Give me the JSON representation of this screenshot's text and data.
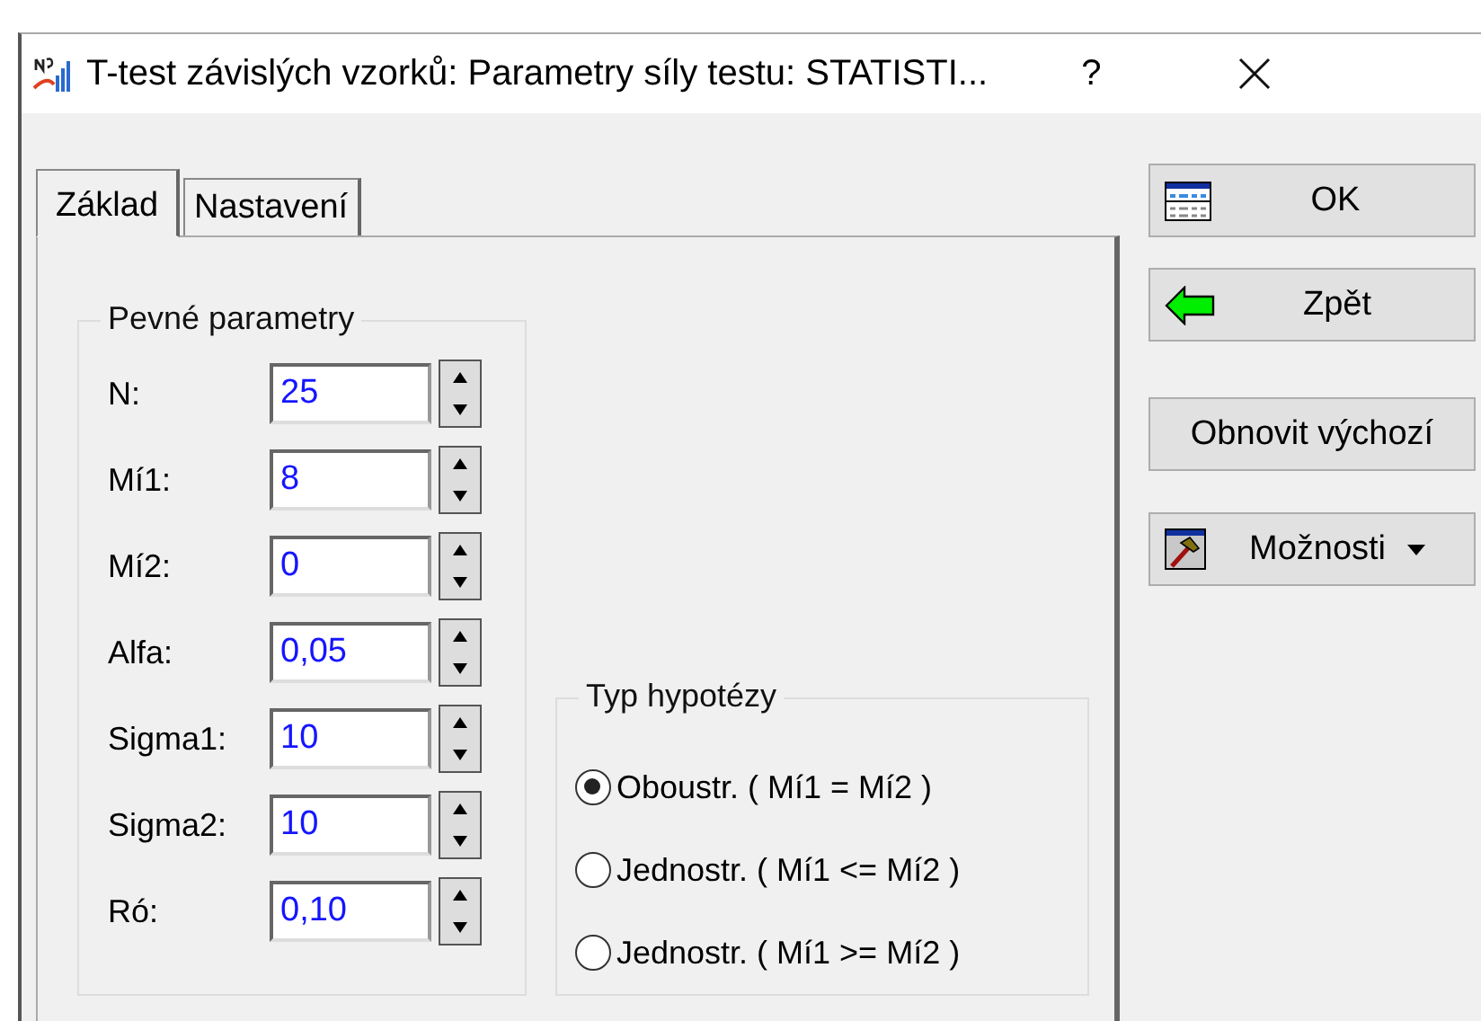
{
  "window": {
    "title": "T-test závislých vzorků: Parametry síly testu: STATISTI...",
    "help": "?"
  },
  "tabs": [
    {
      "label": "Základ",
      "selected": true
    },
    {
      "label": "Nastavení",
      "selected": false
    }
  ],
  "fixed_parameters": {
    "title": "Pevné parametry",
    "fields": [
      {
        "label": "N:",
        "value": "25"
      },
      {
        "label": "Mí1:",
        "value": "8"
      },
      {
        "label": "Mí2:",
        "value": "0"
      },
      {
        "label": "Alfa:",
        "value": "0,05"
      },
      {
        "label": "Sigma1:",
        "value": "10"
      },
      {
        "label": "Sigma2:",
        "value": "10"
      },
      {
        "label": "Ró:",
        "value": "0,10"
      }
    ]
  },
  "hypothesis_type": {
    "title": "Typ hypotézy",
    "options": [
      {
        "label": "Oboustr. ( Mí1 = Mí2 )",
        "selected": true
      },
      {
        "label": "Jednostr. ( Mí1 <= Mí2 )",
        "selected": false
      },
      {
        "label": "Jednostr. ( Mí1 >= Mí2 )",
        "selected": false
      }
    ]
  },
  "buttons": [
    {
      "label": "OK",
      "kind": "table"
    },
    {
      "label": "Zpět",
      "kind": "back"
    },
    {
      "label": "Obnovit výchozí",
      "kind": "plain"
    },
    {
      "label": "Možnosti",
      "kind": "menu"
    }
  ]
}
